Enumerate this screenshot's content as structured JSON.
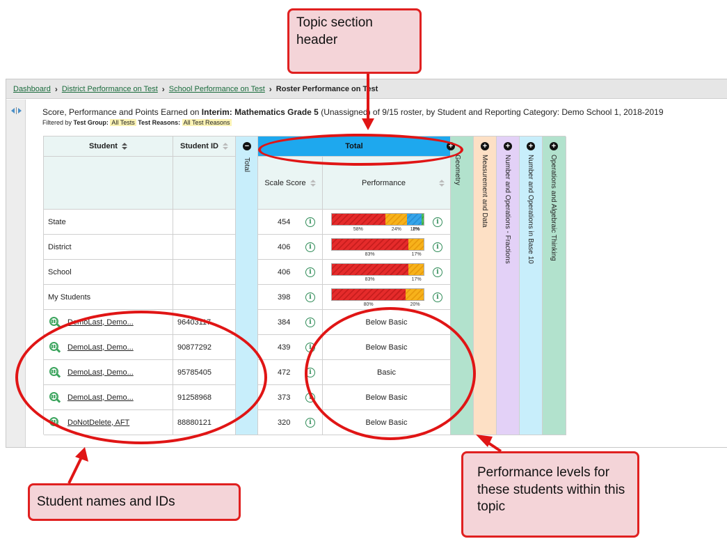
{
  "breadcrumb": {
    "items": [
      "Dashboard",
      "District Performance on Test",
      "School Performance on Test"
    ],
    "current": "Roster Performance on Test"
  },
  "heading": {
    "prefix": "Score, Performance and Points Earned on ",
    "test": "Interim: Mathematics Grade 5",
    "suffix": " (Unassigned) of 9/15 roster, by Student and Reporting Category: Demo School 1, 2018-2019"
  },
  "filters": {
    "prefix": "Filtered by ",
    "group_label": "Test Group:",
    "group_value": "All Tests",
    "reasons_label": "Test Reasons:",
    "reasons_value": "All Test Reasons"
  },
  "table": {
    "col_student": "Student",
    "col_student_id": "Student ID",
    "total_side": "Total",
    "total_header": "Total",
    "col_scale_score": "Scale Score",
    "col_performance": "Performance",
    "topics": [
      "Geometry",
      "Measurement and Data",
      "Number and Operations - Fractions",
      "Number and Operations in Base 10",
      "Operations and Algebraic Thinking"
    ],
    "topic_colors": [
      "#b2e2cd",
      "#fde0c5",
      "#e3d1f7",
      "#c8eefb",
      "#b2e2cd"
    ],
    "aggregate_rows": [
      {
        "label": "State",
        "score": "454",
        "segments": [
          {
            "color": "red",
            "pct": 58,
            "label": "58%"
          },
          {
            "color": "orange",
            "pct": 24,
            "label": "24%"
          },
          {
            "color": "blue",
            "pct": 16,
            "label": "16%"
          },
          {
            "color": "green",
            "pct": 2,
            "label": "2%"
          }
        ]
      },
      {
        "label": "District",
        "score": "406",
        "segments": [
          {
            "color": "red",
            "pct": 83,
            "label": "83%"
          },
          {
            "color": "orange",
            "pct": 17,
            "label": "17%"
          }
        ]
      },
      {
        "label": "School",
        "score": "406",
        "segments": [
          {
            "color": "red",
            "pct": 83,
            "label": "83%"
          },
          {
            "color": "orange",
            "pct": 17,
            "label": "17%"
          }
        ]
      },
      {
        "label": "My Students",
        "score": "398",
        "segments": [
          {
            "color": "red",
            "pct": 80,
            "label": "80%"
          },
          {
            "color": "orange",
            "pct": 20,
            "label": "20%"
          }
        ]
      }
    ],
    "student_rows": [
      {
        "name": "DemoLast, Demo...",
        "id": "96403117",
        "score": "384",
        "performance": "Below Basic"
      },
      {
        "name": "DemoLast, Demo...",
        "id": "90877292",
        "score": "439",
        "performance": "Below Basic"
      },
      {
        "name": "DemoLast, Demo...",
        "id": "95785405",
        "score": "472",
        "performance": "Basic"
      },
      {
        "name": "DemoLast, Demo...",
        "id": "91258968",
        "score": "373",
        "performance": "Below Basic"
      },
      {
        "name": "DoNotDelete, AFT",
        "id": "88880121",
        "score": "320",
        "performance": "Below Basic"
      }
    ]
  },
  "callouts": {
    "topic_header": "Topic section header",
    "student_names": "Student names and IDs",
    "performance_levels": "Performance levels for these students within this topic"
  },
  "icons": {
    "info": "info-icon",
    "student_report": "magnifier-chart-icon",
    "expand": "plus-circle-icon",
    "collapse": "minus-circle-icon"
  },
  "colors": {
    "callout_border": "#e02020",
    "callout_fill": "#f4d4d8",
    "total_header": "#1ea8ee"
  }
}
